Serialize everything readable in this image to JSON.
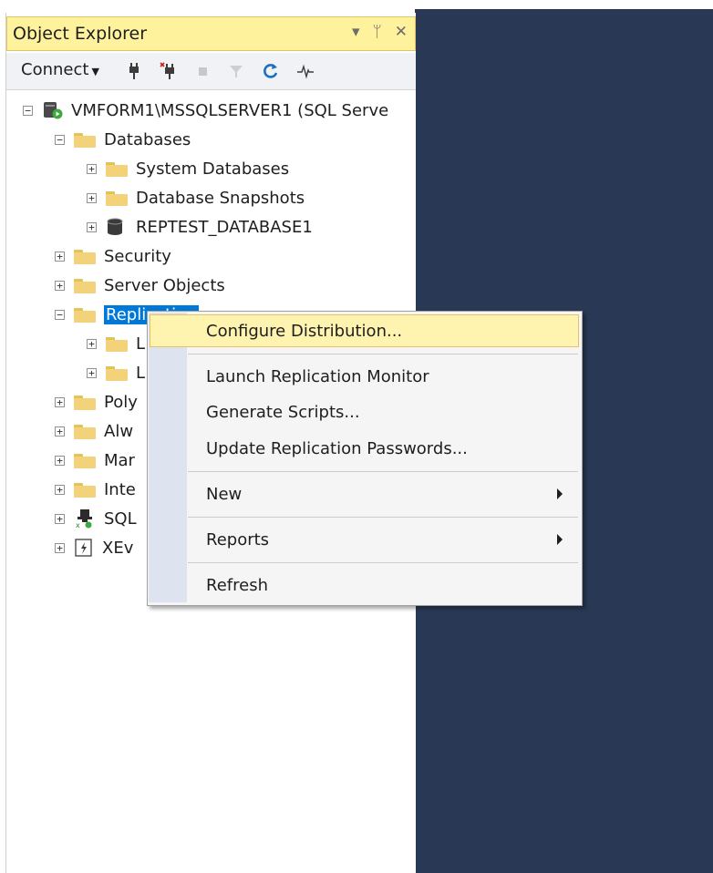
{
  "panel": {
    "title": "Object Explorer",
    "controls": {
      "dropdown": "▾",
      "pin": "ᛘ",
      "close": "✕"
    }
  },
  "toolbar": {
    "connect_label": "Connect",
    "icons": [
      "connect-plug-icon",
      "disconnect-plug-icon",
      "stop-icon",
      "filter-icon",
      "refresh-icon",
      "activity-monitor-icon"
    ]
  },
  "tree": {
    "server": "VMFORM1\\MSSQLSERVER1 (SQL Serve",
    "databases": "Databases",
    "system_databases": "System Databases",
    "database_snapshots": "Database Snapshots",
    "reptest_database": "REPTEST_DATABASE1",
    "security": "Security",
    "server_objects": "Server Objects",
    "replication": "Replication",
    "replication_child1": "L",
    "replication_child2": "L",
    "polybase": "Poly",
    "always_on": "Alw",
    "management": "Mar",
    "integration": "Inte",
    "sql_agent": "SQL",
    "xevent": "XEv"
  },
  "context_menu": {
    "configure_distribution": "Configure Distribution...",
    "launch_replication_monitor": "Launch Replication Monitor",
    "generate_scripts": "Generate Scripts...",
    "update_replication_passwords": "Update Replication Passwords...",
    "new": "New",
    "reports": "Reports",
    "refresh": "Refresh"
  },
  "colors": {
    "title_bar": "#fff29d",
    "selection": "#0078d7",
    "menu_highlight": "#fff3b0",
    "backdrop": "#293955"
  }
}
